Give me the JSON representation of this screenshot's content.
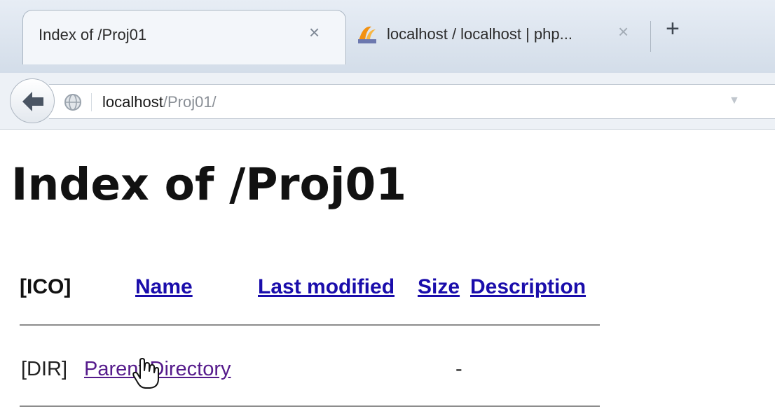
{
  "browser": {
    "tabs": [
      {
        "title": "Index of /Proj01",
        "active": true
      },
      {
        "title": "localhost / localhost | php...",
        "active": false,
        "favicon": "phpmyadmin-icon"
      }
    ],
    "close_glyph": "×",
    "new_tab_glyph": "+",
    "url": {
      "host": "localhost",
      "path": "/Proj01/"
    }
  },
  "page": {
    "heading": "Index of /Proj01",
    "columns": {
      "icon": "[ICO]",
      "name": "Name",
      "last_modified": "Last modified",
      "size": "Size",
      "description": "Description"
    },
    "rows": [
      {
        "icon": "[DIR]",
        "name": "Parent Directory",
        "last_modified": "",
        "size": "-",
        "description": ""
      }
    ]
  },
  "colors": {
    "link": "#1a0dab",
    "visited_link": "#551a8b",
    "chrome": "#d3dde9"
  }
}
